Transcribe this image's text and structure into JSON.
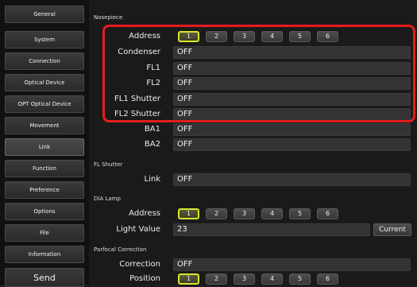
{
  "sidebar": {
    "items": [
      {
        "label": "General"
      },
      {
        "label": "System"
      },
      {
        "label": "Connection"
      },
      {
        "label": "Optical Device"
      },
      {
        "label": "OPT Optical Device"
      },
      {
        "label": "Movement"
      },
      {
        "label": "Link"
      },
      {
        "label": "Function"
      },
      {
        "label": "Preference"
      },
      {
        "label": "Options"
      },
      {
        "label": "File"
      },
      {
        "label": "Information"
      }
    ],
    "send_label": "Send"
  },
  "nosepiece": {
    "title": "Nosepiece",
    "address_label": "Address",
    "address_buttons": [
      "1",
      "2",
      "3",
      "4",
      "5",
      "6"
    ],
    "selected_address": "1",
    "rows": [
      {
        "label": "Condenser",
        "value": "OFF"
      },
      {
        "label": "FL1",
        "value": "OFF"
      },
      {
        "label": "FL2",
        "value": "OFF"
      },
      {
        "label": "FL1 Shutter",
        "value": "OFF"
      },
      {
        "label": "FL2 Shutter",
        "value": "OFF"
      },
      {
        "label": "BA1",
        "value": "OFF"
      },
      {
        "label": "BA2",
        "value": "OFF"
      }
    ]
  },
  "fl_shutter": {
    "title": "FL Shutter",
    "link_label": "Link",
    "link_value": "OFF"
  },
  "dia_lamp": {
    "title": "DIA Lamp",
    "address_label": "Address",
    "address_buttons": [
      "1",
      "2",
      "3",
      "4",
      "5",
      "6"
    ],
    "selected_address": "1",
    "light_value_label": "Light Value",
    "light_value": "23",
    "current_label": "Current"
  },
  "parfocal": {
    "title": "Parfocal Correction",
    "correction_label": "Correction",
    "correction_value": "OFF",
    "position_label": "Position",
    "position_buttons": [
      "1",
      "2",
      "3",
      "4",
      "5",
      "6"
    ],
    "selected_position": "1"
  },
  "colors": {
    "highlight": "#e51d1d",
    "selected_outline": "#d8e62c"
  }
}
